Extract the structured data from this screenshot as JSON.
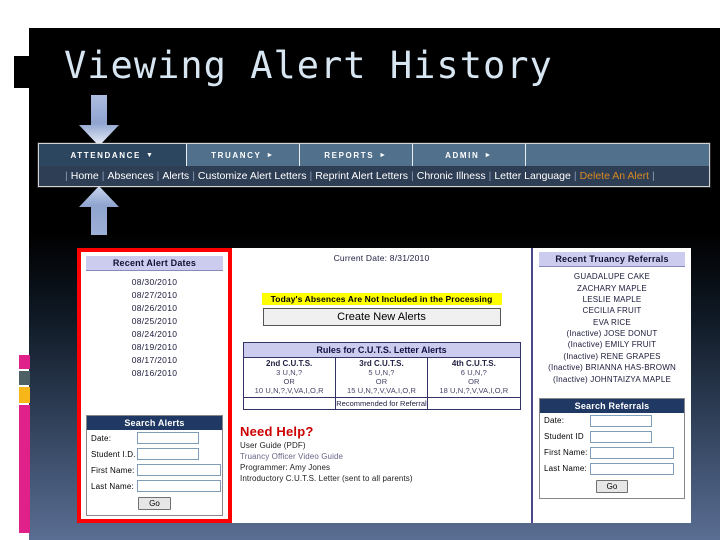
{
  "slide": {
    "title": "Viewing Alert History"
  },
  "nav": {
    "tabs": [
      {
        "label": "ATTENDANCE",
        "caret": "▼",
        "active": true
      },
      {
        "label": "TRUANCY",
        "caret": "►",
        "active": false
      },
      {
        "label": "REPORTS",
        "caret": "►",
        "active": false
      },
      {
        "label": "ADMIN",
        "caret": "►",
        "active": false
      }
    ],
    "sublinks": [
      "Home",
      "Absences",
      "Alerts",
      "Customize Alert Letters",
      "Reprint Alert Letters",
      "Chronic Illness",
      "Letter Language",
      "Delete An Alert"
    ],
    "highlight_link": "Delete An Alert"
  },
  "left_panel": {
    "header": "Recent Alert Dates",
    "dates": [
      "08/30/2010",
      "08/27/2010",
      "08/26/2010",
      "08/25/2010",
      "08/24/2010",
      "08/19/2010",
      "08/17/2010",
      "08/16/2010"
    ],
    "search": {
      "header": "Search Alerts",
      "fields": [
        {
          "label": "Date:",
          "value": "",
          "placeholder": ""
        },
        {
          "label": "Student I.D.",
          "value": "",
          "placeholder": ""
        },
        {
          "label": "First Name:",
          "value": "",
          "placeholder": ""
        },
        {
          "label": "Last Name:",
          "value": "",
          "placeholder": ""
        }
      ],
      "go_label": "Go"
    }
  },
  "center_panel": {
    "current_date_label": "Current Date: 8/31/2010",
    "warning": "Today's Absences Are Not Included in the Processing",
    "create_button": "Create New Alerts",
    "rules": {
      "title": "Rules for C.U.T.S. Letter Alerts",
      "columns": [
        {
          "head": "2nd C.U.T.S.",
          "line1": "3 U,N,?",
          "line2": "OR",
          "line3": "10 U,N,?,V,VA,I,O,R"
        },
        {
          "head": "3rd C.U.T.S.",
          "head_line1": "5 U,N,?",
          "line1": "5 U,N,?",
          "line2": "OR",
          "line3": "15 U,N,?,V,VA,I,O,R"
        },
        {
          "head": "4th C.U.T.S.",
          "line1": "6 U,N,?",
          "line2": "OR",
          "line3": "18 U,N,?,V,VA,I,O,R"
        }
      ],
      "footer_note": "Recommended for Referral"
    },
    "help": {
      "title": "Need Help?",
      "links": [
        "User Guide (PDF)",
        "Truancy Officer Video Guide",
        "Programmer: Amy Jones",
        "Introductory C.U.T.S. Letter (sent to all parents)"
      ]
    }
  },
  "right_panel": {
    "header": "Recent Truancy Referrals",
    "referrals": [
      "GUADALUPE CAKE",
      "ZACHARY MAPLE",
      "LESLIE MAPLE",
      "CECILIA FRUIT",
      "EVA RICE",
      "(Inactive) JOSE DONUT",
      "(Inactive) EMILY FRUIT",
      "(Inactive) RENE GRAPES",
      "(Inactive) BRIANNA HAS-BROWN",
      "(Inactive) JOHNTAIZYA MAPLE"
    ],
    "search": {
      "header": "Search Referrals",
      "fields": [
        {
          "label": "Date:",
          "value": "",
          "placeholder": ""
        },
        {
          "label": "Student ID",
          "value": "",
          "placeholder": ""
        },
        {
          "label": "First Name:",
          "value": "",
          "placeholder": ""
        },
        {
          "label": "Last Name:",
          "value": "",
          "placeholder": ""
        }
      ],
      "go_label": "Go"
    }
  },
  "colors": {
    "title_text": "#d8e6f2",
    "nav_bar": "#51708c",
    "nav_sub": "#2e3e55",
    "highlight_link": "#d88a22",
    "callout_border": "#ff0000",
    "warning_bg": "#ffff00",
    "panel_header": "#ccccee",
    "dark_header": "#1f3864"
  }
}
